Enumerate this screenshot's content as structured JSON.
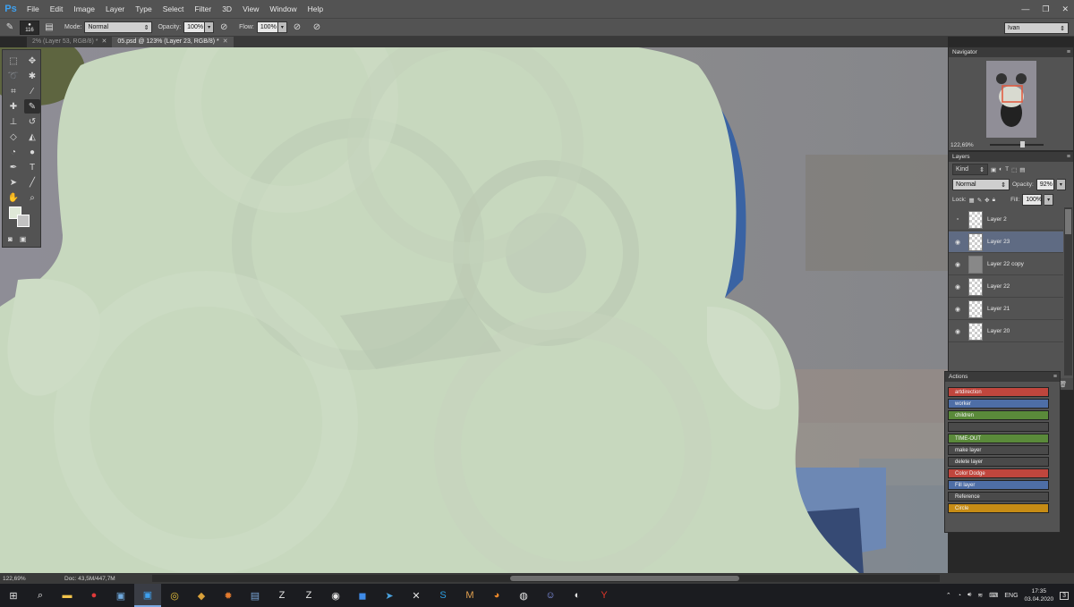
{
  "app": {
    "logo_text": "Ps"
  },
  "menu": [
    "File",
    "Edit",
    "Image",
    "Layer",
    "Type",
    "Select",
    "Filter",
    "3D",
    "View",
    "Window",
    "Help"
  ],
  "window_controls": {
    "minimize": "—",
    "restore": "❐",
    "close": "✕"
  },
  "options": {
    "brush_size": "116",
    "mode_label": "Mode:",
    "mode_value": "Normal",
    "opacity_label": "Opacity:",
    "opacity_value": "100%",
    "flow_label": "Flow:",
    "flow_value": "100%",
    "workspace": "Ivan"
  },
  "tabs": [
    {
      "label": "2% (Layer 53, RGB/8) *",
      "close": "✕",
      "active": false
    },
    {
      "label": "05.psd @ 123% (Layer 23, RGB/8) *",
      "close": "✕",
      "active": true
    }
  ],
  "status": {
    "zoom": "122,69%",
    "doc": "Doc: 43,5M/447,7M",
    "arrow": "›"
  },
  "navigator": {
    "title": "Navigator",
    "zoom": "122,69%"
  },
  "layers": {
    "title": "Layers",
    "kind_label": "Kind",
    "blend_mode": "Normal",
    "opacity_label": "Opacity:",
    "opacity_value": "92%",
    "lock_label": "Lock:",
    "fill_label": "Fill:",
    "fill_value": "100%",
    "items": [
      {
        "name": "Layer 2",
        "visible": false,
        "selected": false
      },
      {
        "name": "Layer 23",
        "visible": true,
        "selected": true
      },
      {
        "name": "Layer 22 copy",
        "visible": true,
        "selected": false
      },
      {
        "name": "Layer 22",
        "visible": true,
        "selected": false
      },
      {
        "name": "Layer 21",
        "visible": true,
        "selected": false
      },
      {
        "name": "Layer 20",
        "visible": true,
        "selected": false
      }
    ]
  },
  "actions": {
    "title": "Actions",
    "items": [
      {
        "label": "artdirection",
        "color": "#c0463d"
      },
      {
        "label": "worker",
        "color": "#4e6ea6"
      },
      {
        "label": "children",
        "color": "#5a8a3a"
      },
      {
        "label": "",
        "color": "#4a4a4a"
      },
      {
        "label": "TIME-OUT",
        "color": "#5a8a3a"
      },
      {
        "label": "make layer",
        "color": "#4a4a4a"
      },
      {
        "label": "delete layer",
        "color": "#4a4a4a"
      },
      {
        "label": "Color Dodge",
        "color": "#c0463d"
      },
      {
        "label": "Fill layer",
        "color": "#4e6ea6"
      },
      {
        "label": "Reference",
        "color": "#4a4a4a"
      },
      {
        "label": "Circle",
        "color": "#c78c15"
      }
    ]
  },
  "taskbar": {
    "icons": [
      "windows-start",
      "search",
      "file-explorer",
      "record",
      "task-manager",
      "photoshop",
      "chrome",
      "ae",
      "blender-like",
      "document",
      "zbrush",
      "zbrush-alt",
      "chrome-alt",
      "zoom",
      "telegram",
      "xnview",
      "skype",
      "mango",
      "blender",
      "obs-like",
      "discord",
      "obs",
      "yandex"
    ],
    "lang": "ENG",
    "time": "17:35",
    "date": "03.04.2020",
    "notifications": "3"
  },
  "colors": {
    "foreground": "#dfe8d7",
    "background": "#c2c2c2",
    "accent": "#3ea1f0"
  }
}
